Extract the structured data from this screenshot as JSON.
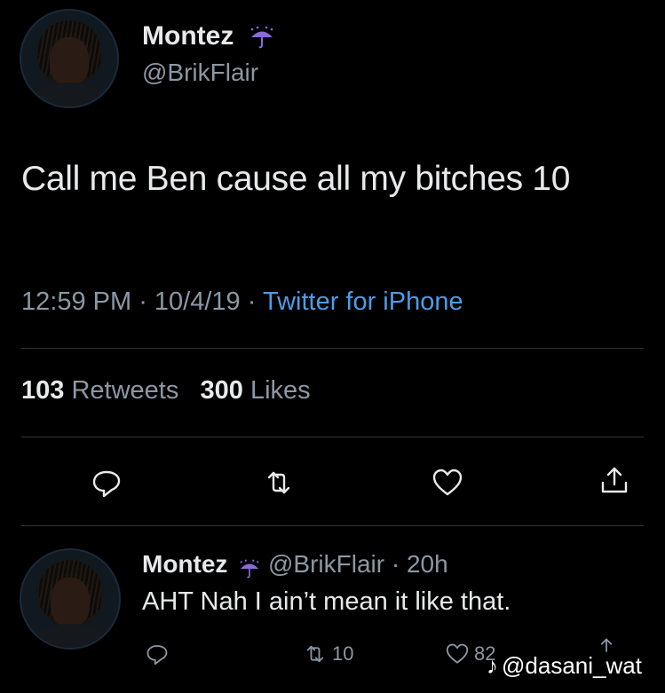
{
  "tweet": {
    "author_name": "Montez",
    "author_handle": "@BrikFlair",
    "text": "Call me Ben cause all my bitches 10",
    "time": "12:59 PM",
    "date": "10/4/19",
    "source": "Twitter for iPhone",
    "retweets_count": "103",
    "retweets_label": "Retweets",
    "likes_count": "300",
    "likes_label": "Likes"
  },
  "reply": {
    "author_name": "Montez",
    "author_handle": "@BrikFlair",
    "age": "20h",
    "text": "AHT Nah I ain’t mean it like that.",
    "retweets_count": "10",
    "likes_count": "82"
  },
  "watermark": {
    "logo": "♪",
    "handle": "@dasani_wat"
  },
  "colors": {
    "background": "#000000",
    "text": "#e7e9ea",
    "muted": "#8b98a5",
    "link": "#4f9be6",
    "umbrella": "#8a6bd8"
  },
  "icons": [
    "umbrella-rain-icon",
    "reply-icon",
    "retweet-icon",
    "like-icon",
    "share-icon"
  ]
}
